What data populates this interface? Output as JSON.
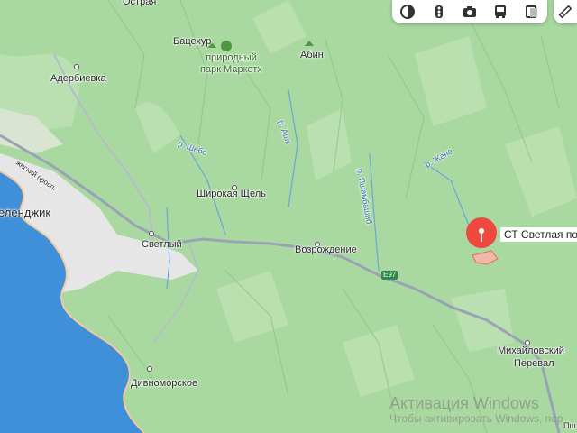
{
  "map": {
    "colors": {
      "forest": "#a9d8a0",
      "forest_light": "#c5e6bd",
      "sea": "#3f8fd9",
      "city": "#e4e4e4",
      "road": "#9aa3b5",
      "pin": "#f0483e",
      "area": "#e88a7a"
    },
    "labels": {
      "ostraya": "Острая",
      "bacehur": "Бацехур",
      "abin": "Абин",
      "park": "природный\nпарк Маркотх",
      "aderbievka": "Адербиевка",
      "river_ashe": "р. Ашк",
      "river_sheb": "р. Шебс",
      "river_zhane": "р. Жане",
      "river_yashamba": "р. Яшамбашиб",
      "gelendzhik": "еленджик",
      "road_name": "жнский просп.",
      "shirokaya": "Широкая Щель",
      "svetly": "Светлый",
      "vozrozhdenie": "Возрождение",
      "route": "E97",
      "divnomorskoe": "Дивноморское",
      "mikhailovsky": "Михайловский",
      "pereval": "Перевал",
      "pshada": "Пш"
    },
    "pin": {
      "label": "СТ Светлая пол"
    },
    "toolbar": {
      "icons": [
        "layers-icon",
        "traffic-icon",
        "panorama-icon",
        "transport-icon",
        "ruler-toggle-icon"
      ]
    },
    "watermark": {
      "title": "Активация Windows",
      "subtitle": "Чтобы активировать Windows, пер"
    }
  }
}
